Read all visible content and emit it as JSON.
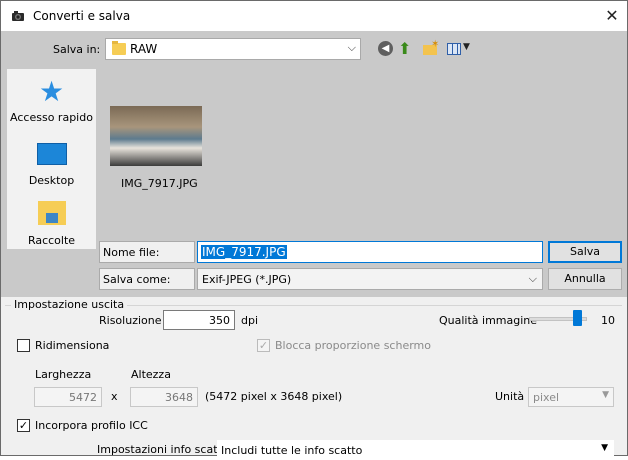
{
  "window": {
    "title": "Converti e salva",
    "close_glyph": "✕"
  },
  "toolbar": {
    "save_in_label": "Salva in:",
    "save_in_value": "RAW",
    "back_icon": "back-icon",
    "up_icon": "up-folder-icon",
    "new_folder_icon": "new-folder-icon",
    "view_icon": "view-menu-icon"
  },
  "places": [
    {
      "label": "Accesso rapido",
      "icon": "star-icon"
    },
    {
      "label": "Desktop",
      "icon": "desktop-icon"
    },
    {
      "label": "Raccolte",
      "icon": "libraries-icon"
    }
  ],
  "files": [
    {
      "name": "IMG_7917.JPG"
    }
  ],
  "filename": {
    "label": "Nome file:",
    "value": "IMG_7917.JPG"
  },
  "savetype": {
    "label": "Salva come:",
    "value": "Exif-JPEG (*.JPG)"
  },
  "buttons": {
    "save": "Salva",
    "cancel": "Annulla"
  },
  "output": {
    "group_title": "Impostazione uscita",
    "resolution_label": "Risoluzione",
    "resolution_value": "350",
    "resolution_unit": "dpi",
    "quality_label": "Qualità immagine",
    "quality_value": "10",
    "quality_fraction": 0.9,
    "resize_label": "Ridimensiona",
    "resize_checked": false,
    "lock_ratio_label": "Blocca proporzione schermo",
    "lock_ratio_checked": true,
    "width_label": "Larghezza",
    "height_label": "Altezza",
    "width_value": "5472",
    "height_value": "3648",
    "times": "x",
    "pixel_summary": "(5472 pixel x 3648 pixel)",
    "unit_label": "Unità",
    "unit_value": "pixel",
    "icc_label": "Incorpora profilo ICC",
    "icc_checked": true,
    "shot_info_label": "Impostazioni info scatto",
    "shot_info_value": "Includi tutte le info scatto"
  }
}
